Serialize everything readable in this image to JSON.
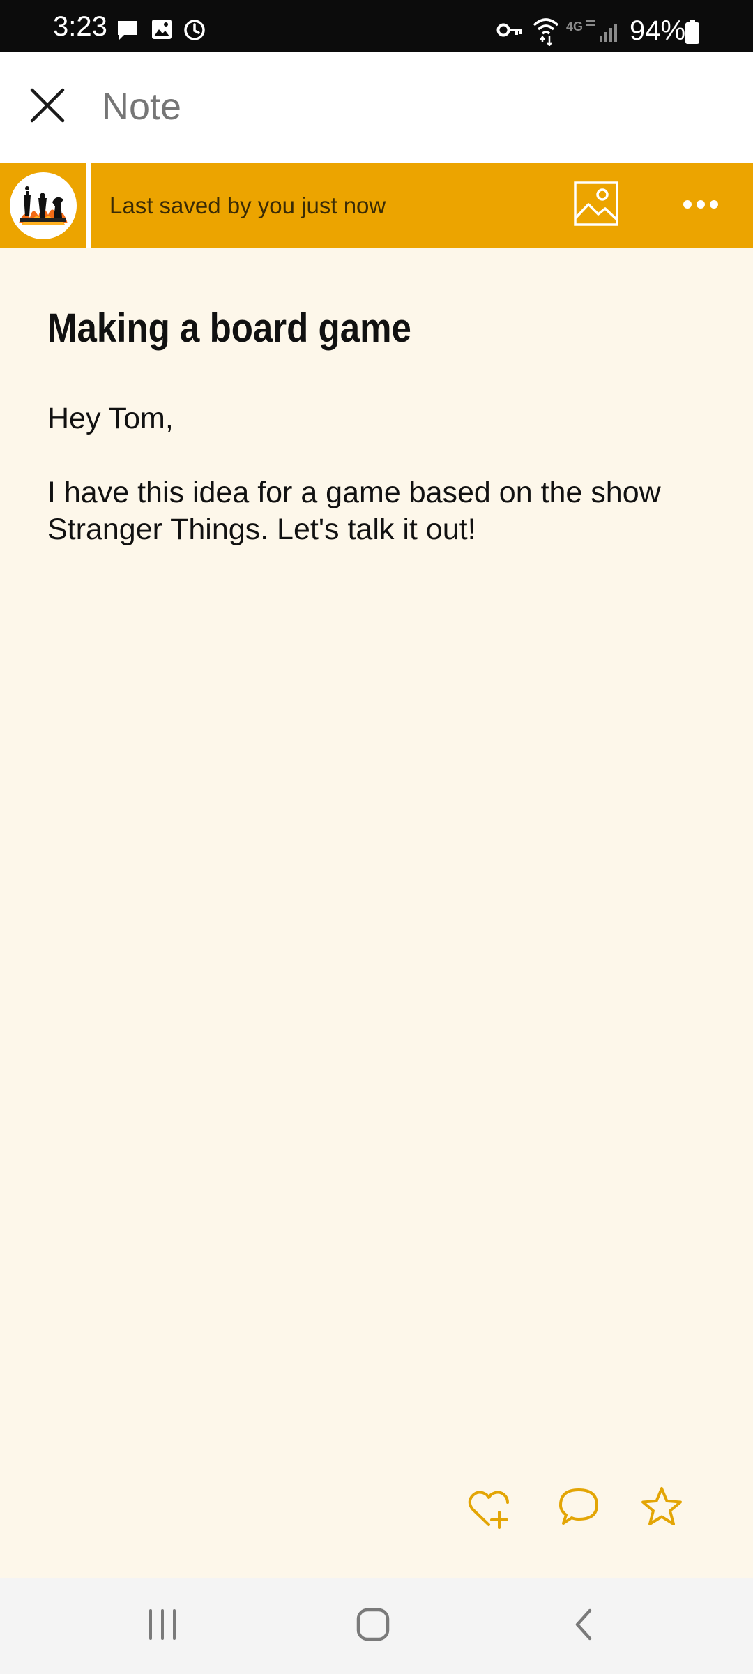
{
  "status_bar": {
    "time": "3:23",
    "battery_percent": "94%",
    "left_icons": [
      "message-icon",
      "gallery-icon",
      "alarm-icon"
    ],
    "right_icons": [
      "vpn-key-icon",
      "wifi-icon",
      "network-4g-icon",
      "signal-icon",
      "battery-icon"
    ]
  },
  "app_bar": {
    "title": "Note",
    "close_icon": "close-icon"
  },
  "banner": {
    "status": "Last saved by you just now",
    "avatar_icon": "chess-avatar-icon",
    "image_icon": "image-icon",
    "more_icon": "more-icon",
    "color": "#ECA400"
  },
  "note": {
    "title": "Making a board game",
    "body": "Hey Tom,\n\nI have this idea for a game based on the show Stranger Things. Let's talk it out!",
    "background": "#FDF7EA"
  },
  "note_actions": {
    "icons": [
      "heart-add-icon",
      "comment-icon",
      "star-icon"
    ],
    "accent": "#E3A505"
  },
  "nav_bar": {
    "icons": [
      "recents-icon",
      "home-icon",
      "back-icon"
    ]
  }
}
